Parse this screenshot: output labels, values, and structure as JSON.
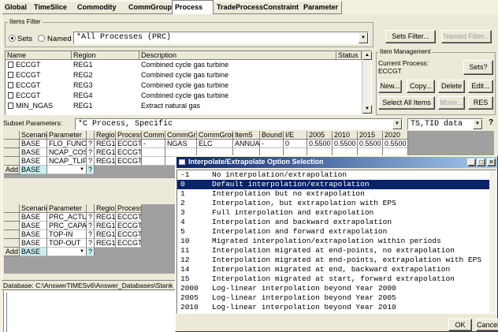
{
  "tabs": [
    "Global",
    "TimeSlice",
    "Commodity",
    "CommGroup",
    "Process",
    "TradeProcess",
    "Constraint",
    "Parameter"
  ],
  "active_tab": "Process",
  "items_filter": {
    "label": "Items Filter",
    "sets_label": "Sets",
    "named_label": "Named",
    "value": "*All Processes (PRC)",
    "sets_filter_button": "Sets Filter...",
    "named_filter_button": "Named Filter..."
  },
  "process_table": {
    "columns": [
      "Name",
      "Region",
      "Description",
      "Status"
    ],
    "rows": [
      {
        "name": "ECCGT",
        "region": "REG1",
        "description": "Combined cycle gas turbine"
      },
      {
        "name": "ECCGT",
        "region": "REG2",
        "description": "Combined cycle gas turbine"
      },
      {
        "name": "ECCGT",
        "region": "REG3",
        "description": "Combined cycle gas turbine"
      },
      {
        "name": "ECCGT",
        "region": "REG4",
        "description": "Combined cycle gas turbine"
      },
      {
        "name": "MIN_NGAS",
        "region": "REG1",
        "description": "Extract natural gas"
      }
    ]
  },
  "item_management": {
    "label": "Item Management",
    "current_process_label": "Current Process:",
    "current_process": "ECCGT",
    "sets_button": "Sets?",
    "new_button": "New...",
    "copy_button": "Copy...",
    "delete_button": "Delete",
    "edit_button": "Edit...",
    "select_all_button": "Select All Items",
    "move_button": "Move...",
    "res_button": "RES"
  },
  "subset": {
    "label": "Subset Parameters:",
    "value": "*C  Process, Specific",
    "view_value": "TS,TID data",
    "help": "?"
  },
  "grid1": {
    "columns": [
      "Scenario",
      "Parameter",
      "",
      "Region",
      "Process",
      "Commodi",
      "CommGrou",
      "CommGroup",
      "Item5",
      "Bound",
      "I/E",
      "2005",
      "2010",
      "2015",
      "2020"
    ],
    "rows": [
      [
        "BASE",
        "FLO_FUNC",
        "?",
        "REG1",
        "ECCGT",
        "-",
        "NGAS",
        "ELC",
        "ANNUAL",
        "-",
        "0",
        "0.5500",
        "0.5500",
        "0.5500",
        "0.5500"
      ],
      [
        "BASE",
        "NCAP_COST",
        "?",
        "REG1",
        "ECCGT",
        "",
        "",
        "",
        "",
        "",
        "",
        "",
        "",
        "",
        ""
      ],
      [
        "BASE",
        "NCAP_TLIFE",
        "?",
        "REG1",
        "ECCGT",
        "",
        "",
        "",
        "",
        "",
        "",
        "",
        "",
        "",
        ""
      ]
    ],
    "add_label": "Add",
    "add_scenario": "BASE"
  },
  "grid2": {
    "columns": [
      "Scenario",
      "Parameter",
      "",
      "Region",
      "Process"
    ],
    "rows": [
      [
        "BASE",
        "PRC_ACTUNT",
        "?",
        "REG1",
        "ECCGT"
      ],
      [
        "BASE",
        "PRC_CAPACT",
        "?",
        "REG1",
        "ECCGT"
      ],
      [
        "BASE",
        "TOP-IN",
        "?",
        "REG1",
        "ECCGT"
      ],
      [
        "BASE",
        "TOP-OUT",
        "?",
        "REG1",
        "ECCGT"
      ]
    ],
    "add_label": "Add",
    "add_scenario": "BASE"
  },
  "status_bar": "Database: C:\\AnswerTIMESv6\\Answer_Databases\\Stank",
  "dialog": {
    "title": "Interpolate/Extrapolate Option Selection",
    "selected_index": 1,
    "options": [
      {
        "code": "-1",
        "text": "No interpolation/extrapolation"
      },
      {
        "code": "0",
        "text": "Default interpolation/extrapolation"
      },
      {
        "code": "1",
        "text": "Interpolation but no extrapolation"
      },
      {
        "code": "2",
        "text": "Interpolation, but extrapolation with EPS"
      },
      {
        "code": "3",
        "text": "Full interpolation and extrapolation"
      },
      {
        "code": "4",
        "text": "Interpolation and backward extrapolation"
      },
      {
        "code": "5",
        "text": "Interpolation and forward extrapolation"
      },
      {
        "code": "10",
        "text": "Migrated interpolation/extrapolation within periods"
      },
      {
        "code": "11",
        "text": "Interpolation migrated at end-points, no extrapolation"
      },
      {
        "code": "12",
        "text": "Interpolation migrated at end-points, extrapolation with EPS"
      },
      {
        "code": "14",
        "text": "Interpolation migrated at end, backward extrapolation"
      },
      {
        "code": "15",
        "text": "Interpolation migrated at start, forward extrapolation"
      },
      {
        "code": "2000",
        "text": "Log-linear interpolation beyond Year 2000"
      },
      {
        "code": "2005",
        "text": "Log-linear interpolation beyond Year 2005"
      },
      {
        "code": "2010",
        "text": "Log-linear interpolation beyond Year 2010"
      }
    ],
    "ok_button": "OK",
    "cancel_button": "Cancel",
    "title_bar_color": "#0a246a"
  }
}
